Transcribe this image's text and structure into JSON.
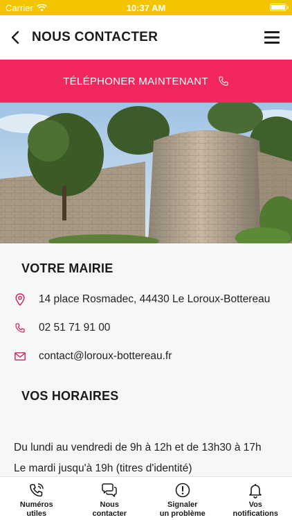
{
  "status_bar": {
    "carrier": "Carrier",
    "time": "10:37 AM"
  },
  "header": {
    "title": "NOUS CONTACTER"
  },
  "call_button": {
    "label": "TÉLÉPHONER MAINTENANT"
  },
  "mairie": {
    "title": "VOTRE MAIRIE",
    "address": "14 place Rosmadec, 44430 Le Loroux-Bottereau",
    "phone": "02 51 71 91 00",
    "email": "contact@loroux-bottereau.fr"
  },
  "horaires": {
    "title": "VOS HORAIRES",
    "lines": [
      "Du lundi au vendredi de 9h à 12h et de 13h30 à 17h",
      "Le mardi jusqu'à 19h (titres d'identité)"
    ]
  },
  "tabbar": {
    "items": [
      {
        "line1": "Numéros",
        "line2": "utiles"
      },
      {
        "line1": "Nous",
        "line2": "contacter"
      },
      {
        "line1": "Signaler",
        "line2": "un problème"
      },
      {
        "line1": "Vos",
        "line2": "notifications"
      }
    ]
  },
  "colors": {
    "status_bar": "#f5c400",
    "accent": "#f2275d",
    "icon_accent": "#d61f57"
  },
  "icons": {
    "back": "chevron-left-icon",
    "menu": "hamburger-menu-icon",
    "phone": "phone-icon",
    "pin": "location-pin-icon",
    "mail": "mail-icon",
    "wifi": "wifi-icon",
    "tabs": [
      "phone-ringing-icon",
      "chat-bubbles-icon",
      "alert-circle-icon",
      "bell-icon"
    ]
  }
}
